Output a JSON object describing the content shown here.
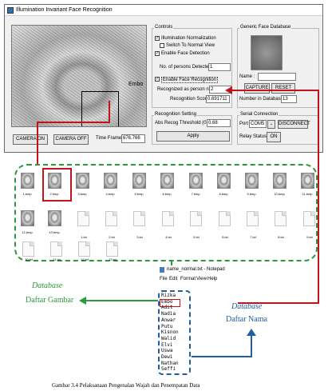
{
  "window": {
    "title": "Illumination Invariant Face Recognition"
  },
  "video": {
    "overlay_name": "Embo"
  },
  "bottom_bar": {
    "camera_on": "CAMERA ON",
    "camera_off": "CAMERA OFF",
    "time_frame_label": "Time Frame =",
    "time_frame_value": "676.766"
  },
  "controls": {
    "title": "Controls",
    "illumination_normalization": "Illumination Normalization",
    "switch_normal_view": "Switch To Normal View",
    "enable_face_detection": "Enable Face Detection",
    "num_persons_label": "No. of persons Detected :",
    "num_persons_value": "1",
    "enable_face_recognition": "Enable Face Recognition",
    "recognized_as_label": "Recognized as person no :",
    "recognized_as_value": "2",
    "recognition_score_label": "Recognition Score :",
    "recognition_score_value": "0.691711"
  },
  "recognition_setting": {
    "title": "Recognition Setting",
    "threshold_label": "Abs Recog Threshold (0-1):",
    "threshold_value": "0.68",
    "apply": "Apply"
  },
  "generic_db": {
    "title": "Generic Face Database",
    "name_label": "Name :",
    "name_value": "",
    "capture": "CAPTURE",
    "reset": "RESET",
    "number_label": "Number in Database :",
    "number_value": "13"
  },
  "serial": {
    "title": "Serial Connection",
    "port_label": "Port",
    "port_value": "COM5",
    "connect": "DISCONNECT",
    "relay_label": "Relay Status:",
    "relay_value": "ON"
  },
  "files": {
    "row1": [
      "1.bmp",
      "2.bmp",
      "3.bmp",
      "4.bmp",
      "5.bmp",
      "6.bmp",
      "7.bmp",
      "8.bmp",
      "9.bmp",
      "10.bmp",
      "11.bmp"
    ],
    "row2_bmp": [
      "12.bmp",
      "13.bmp"
    ],
    "row2_txt": [
      "1.txt",
      "2.txt",
      "3.txt",
      "4.txt",
      "5.txt",
      "6.txt",
      "7.txt",
      "8.txt",
      "9.txt"
    ],
    "row3_txt": [
      "10.txt",
      "11.txt",
      "12.txt",
      "13.txt"
    ]
  },
  "labels": {
    "database_left": "Database",
    "daftar_gambar": "Daftar Gambar",
    "database_right": "Database",
    "daftar_nama": "Daftar Nama"
  },
  "notepad": {
    "title": "name_normal.txt - Notepad",
    "menu": [
      "File",
      "Edit",
      "Format",
      "View",
      "Help"
    ],
    "names": [
      "Rizka",
      "Embo",
      "Adit",
      "Nadia",
      "Anwar",
      "Putu",
      "Kisnon",
      "Walid",
      "Elvi",
      "Uswa",
      "Dewi",
      "Nathan",
      "Seffi"
    ]
  },
  "caption": "Gambar 3.4 Pelaksanaan Pengenalan Wajah dan Penempatan Data",
  "colors": {
    "arrow_red": "#c0141c",
    "dash_green": "#2a9a3a",
    "label_blue": "#2060a0"
  }
}
